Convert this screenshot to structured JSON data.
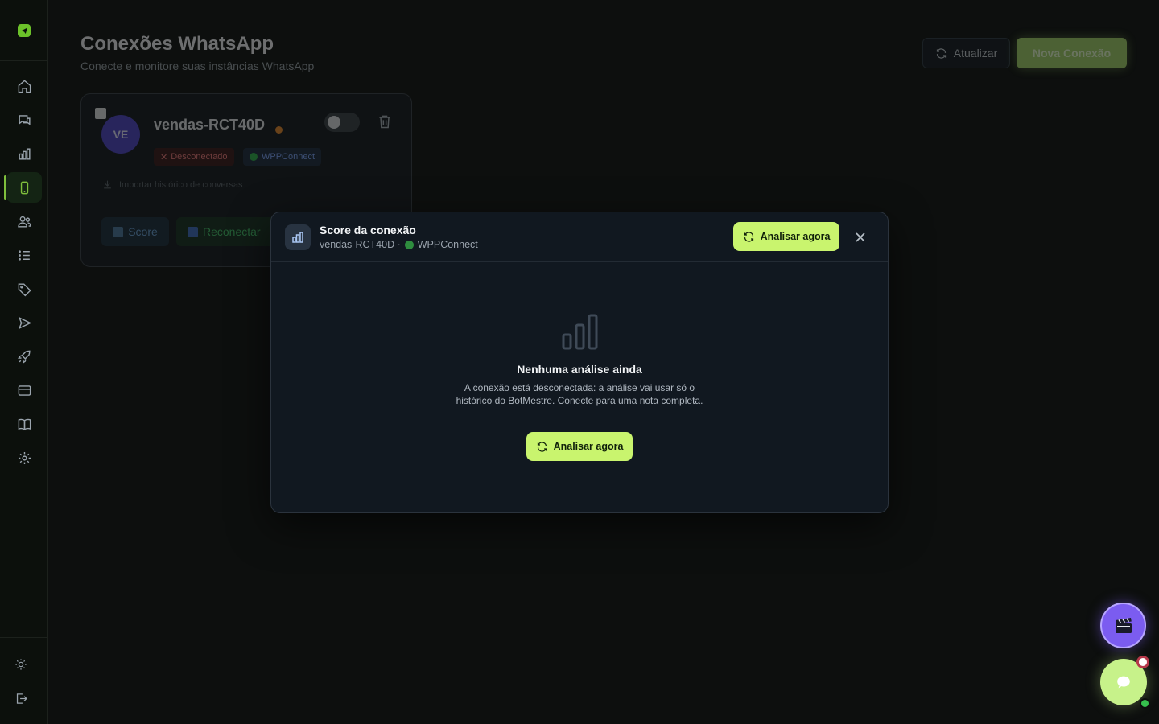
{
  "sidebar": {
    "items": [
      {
        "name": "home-icon"
      },
      {
        "name": "chat-icon"
      },
      {
        "name": "chart-icon"
      },
      {
        "name": "phone-icon",
        "active": true
      },
      {
        "name": "users-icon"
      },
      {
        "name": "list-icon"
      },
      {
        "name": "tag-icon"
      },
      {
        "name": "send-icon"
      },
      {
        "name": "rocket-icon"
      },
      {
        "name": "card-icon"
      },
      {
        "name": "book-icon"
      },
      {
        "name": "gear-icon"
      }
    ],
    "accent": "#7fbf3c"
  },
  "header": {
    "title": "Conexões WhatsApp",
    "subtitle": "Conecte e monitore suas instâncias WhatsApp",
    "refresh_label": "Atualizar",
    "new_label": "Nova Conexão"
  },
  "connection": {
    "avatar": "VE",
    "name": "vendas-RCT40D",
    "status": "Desconectado",
    "provider": "WPPConnect",
    "import_label": "Importar histórico de conversas",
    "score_label": "Score",
    "reconnect_label": "Reconectar"
  },
  "modal": {
    "title": "Score da conexão",
    "subtitle_name": "vendas-RCT40D ·",
    "subtitle_provider": "WPPConnect",
    "analyze_label": "Analisar agora",
    "empty_title": "Nenhuma análise ainda",
    "empty_text": "A conexão está desconectada: a análise vai usar só o histórico do BotMestre. Conecte para uma nota completa.",
    "analyze_label_center": "Analisar agora"
  },
  "colors": {
    "brand_green": "#c9f46e",
    "disconnected": "#f27c7c",
    "provider": "#7ea8ff",
    "video_fab": "#7b5cf0"
  }
}
